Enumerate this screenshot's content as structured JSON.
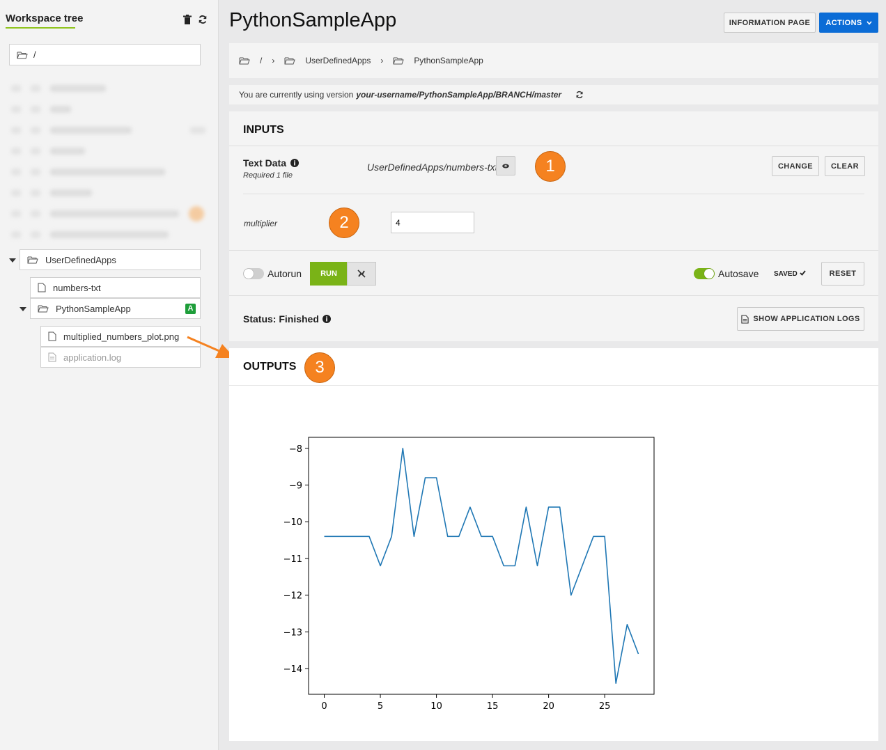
{
  "sidebar": {
    "title": "Workspace tree",
    "path": "/",
    "tree": {
      "user_defined_apps": "UserDefinedApps",
      "numbers_txt": "numbers-txt",
      "python_sample_app": "PythonSampleApp",
      "app_badge": "A",
      "plot_file": "multiplied_numbers_plot.png",
      "log_file": "application.log"
    }
  },
  "header": {
    "title": "PythonSampleApp",
    "info_button": "INFORMATION PAGE",
    "actions_button": "ACTIONS"
  },
  "breadcrumb": {
    "root": "/",
    "items": [
      "UserDefinedApps",
      "PythonSampleApp"
    ]
  },
  "version": {
    "prefix": "You are currently using version",
    "value": "your-username/PythonSampleApp/BRANCH/master"
  },
  "inputs": {
    "heading": "INPUTS",
    "text_data_label": "Text Data",
    "text_data_hint": "Required 1 file",
    "text_data_value": "UserDefinedApps/numbers-txt",
    "change_button": "CHANGE",
    "clear_button": "CLEAR",
    "multiplier_label": "multiplier",
    "multiplier_value": "4",
    "autorun_label": "Autorun",
    "run_button": "RUN",
    "autosave_label": "Autosave",
    "saved_label": "SAVED",
    "reset_button": "RESET",
    "status_label": "Status: Finished",
    "logs_button": "SHOW APPLICATION LOGS"
  },
  "outputs": {
    "heading": "OUTPUTS"
  },
  "markers": [
    "1",
    "2",
    "3"
  ],
  "colors": {
    "primary": "#0b6cd6",
    "run_green": "#7ab317",
    "marker_orange": "#f58220",
    "line": "#1f77b4"
  },
  "chart_data": {
    "type": "line",
    "title": "",
    "xlabel": "",
    "ylabel": "",
    "xlim": [
      -1.4,
      29.4
    ],
    "ylim": [
      -14.7,
      -7.7
    ],
    "xticks": [
      0,
      5,
      10,
      15,
      20,
      25
    ],
    "yticks": [
      -8,
      -9,
      -10,
      -11,
      -12,
      -13,
      -14
    ],
    "grid": false,
    "series": [
      {
        "x": [
          0,
          1,
          2,
          3,
          4,
          5,
          6,
          7,
          8,
          9,
          10,
          11,
          12,
          13,
          14,
          15,
          16,
          17,
          18,
          19,
          20,
          21,
          22,
          23,
          24,
          25,
          26,
          27,
          28
        ],
        "values": [
          -10.4,
          -10.4,
          -10.4,
          -10.4,
          -10.4,
          -11.2,
          -10.4,
          -8.0,
          -10.4,
          -8.8,
          -8.8,
          -10.4,
          -10.4,
          -9.6,
          -10.4,
          -10.4,
          -11.2,
          -11.2,
          -9.6,
          -11.2,
          -9.6,
          -9.6,
          -12.0,
          -11.2,
          -10.4,
          -10.4,
          -14.4,
          -12.8,
          -13.6
        ]
      }
    ]
  }
}
